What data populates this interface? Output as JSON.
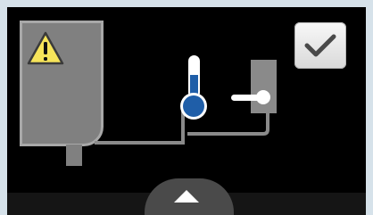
{
  "screen": {
    "warning_icon": "warning-triangle",
    "thermometer_icon": "thermometer",
    "confirm_icon": "checkmark",
    "up_icon": "up-arrow",
    "colors": {
      "background": "#d6e2ea",
      "screen": "#000000",
      "gray": "#808080",
      "blue": "#1f5ea8",
      "warning_yellow": "#f6e45a"
    }
  }
}
